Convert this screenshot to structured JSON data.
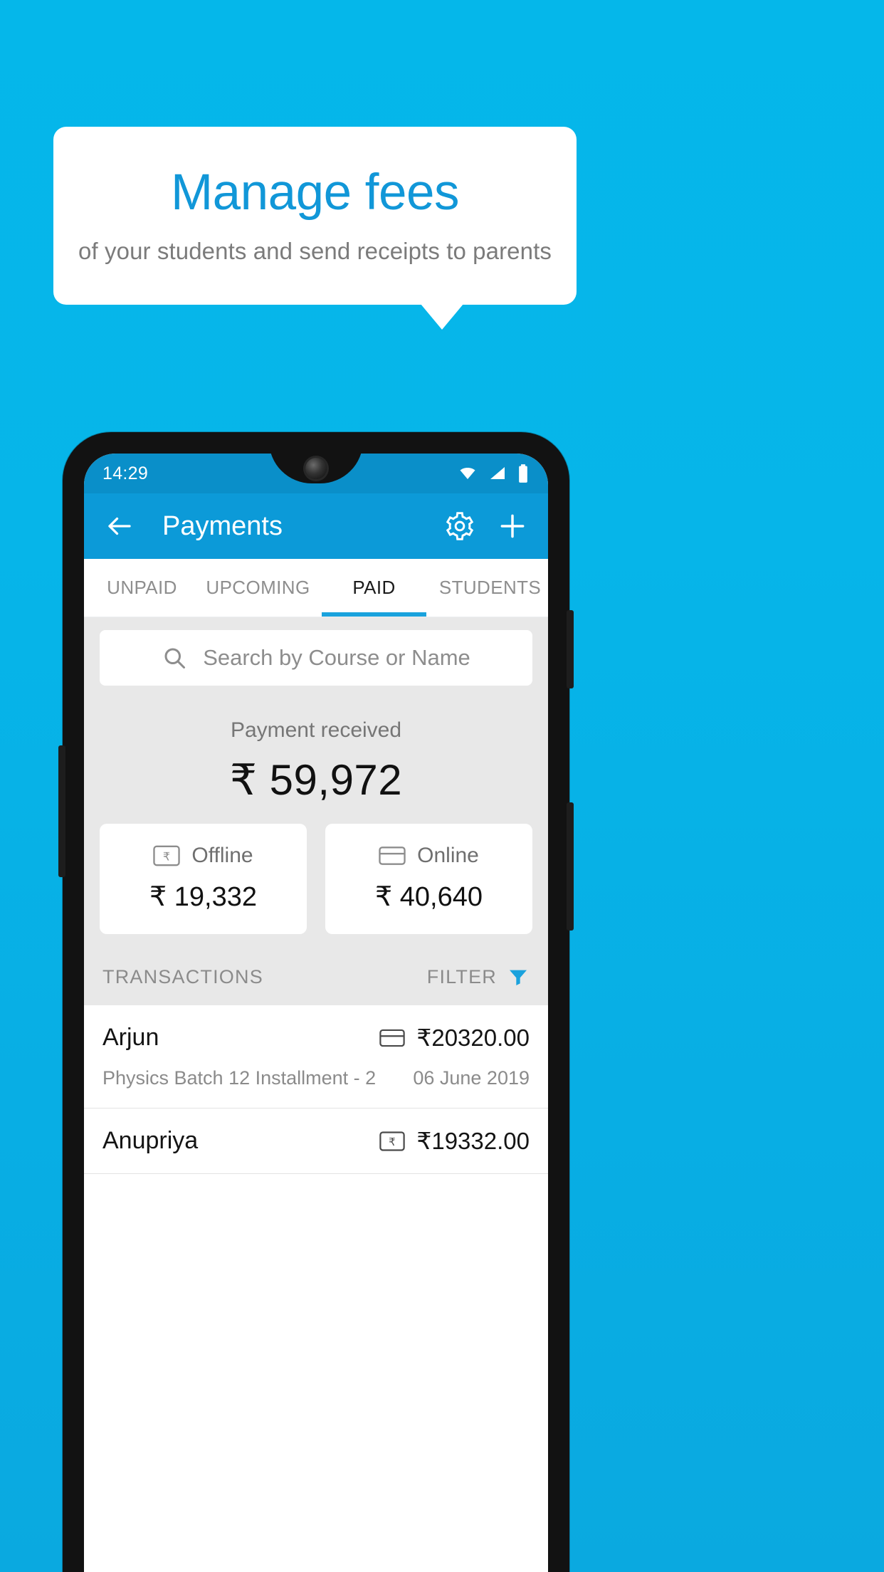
{
  "promo": {
    "title": "Manage fees",
    "subtitle": "of your students and send receipts to parents",
    "title_color": "#1197d8",
    "background_color": "#06b5e9"
  },
  "phone": {
    "status_bar": {
      "time": "14:29",
      "icons": [
        "wifi-icon",
        "signal-icon",
        "battery-icon"
      ]
    },
    "app_bar": {
      "back_icon": "back-arrow-icon",
      "title": "Payments",
      "settings_icon": "gear-icon",
      "add_icon": "plus-icon",
      "background_color": "#0c9ad8"
    },
    "tabs": [
      {
        "label": "UNPAID",
        "active": false
      },
      {
        "label": "UPCOMING",
        "active": false
      },
      {
        "label": "PAID",
        "active": true
      },
      {
        "label": "STUDENTS",
        "active": false
      }
    ],
    "search": {
      "icon": "search-icon",
      "placeholder": "Search by Course or Name",
      "value": ""
    },
    "summary": {
      "label": "Payment received",
      "amount": "₹ 59,972"
    },
    "method_cards": [
      {
        "icon": "rupee-note-icon",
        "label": "Offline",
        "amount": "₹ 19,332"
      },
      {
        "icon": "credit-card-icon",
        "label": "Online",
        "amount": "₹ 40,640"
      }
    ],
    "list_header": {
      "title": "TRANSACTIONS",
      "filter_label": "FILTER",
      "filter_icon": "funnel-icon",
      "filter_icon_color": "#1aa2dd"
    },
    "transactions": [
      {
        "name": "Arjun",
        "description": "Physics Batch 12 Installment - 2",
        "amount": "₹20320.00",
        "date": "06 June 2019",
        "method_icon": "credit-card-icon"
      },
      {
        "name": "Anupriya",
        "description": "",
        "amount": "₹19332.00",
        "date": "",
        "method_icon": "rupee-note-icon"
      }
    ]
  }
}
